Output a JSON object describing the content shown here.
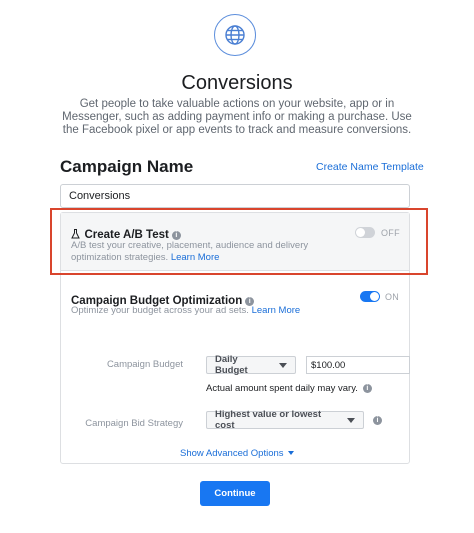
{
  "header": {
    "icon": "globe-icon",
    "title": "Conversions",
    "description": "Get people to take valuable actions on your website, app or in Messenger, such as adding payment info or making a purchase. Use the Facebook pixel or app events to track and measure conversions."
  },
  "campaign_name": {
    "label": "Campaign Name",
    "template_link": "Create Name Template",
    "value": "Conversions"
  },
  "ab_test": {
    "icon": "flask-icon",
    "title": "Create A/B Test",
    "description": "A/B test your creative, placement, audience and delivery optimization strategies.",
    "learn_more": "Learn More",
    "toggle_label": "OFF",
    "enabled": false
  },
  "cbo": {
    "title": "Campaign Budget Optimization",
    "description": "Optimize your budget across your ad sets.",
    "learn_more": "Learn More",
    "toggle_label": "ON",
    "enabled": true
  },
  "budget": {
    "label": "Campaign Budget",
    "type": "Daily Budget",
    "amount": "$100.00",
    "hint": "Actual amount spent daily may vary."
  },
  "bid_strategy": {
    "label": "Campaign Bid Strategy",
    "value": "Highest value or lowest cost"
  },
  "advanced_link": "Show Advanced Options",
  "continue_label": "Continue",
  "colors": {
    "accent": "#1877f2",
    "link": "#1a6ed8",
    "highlight": "#d9452d"
  }
}
